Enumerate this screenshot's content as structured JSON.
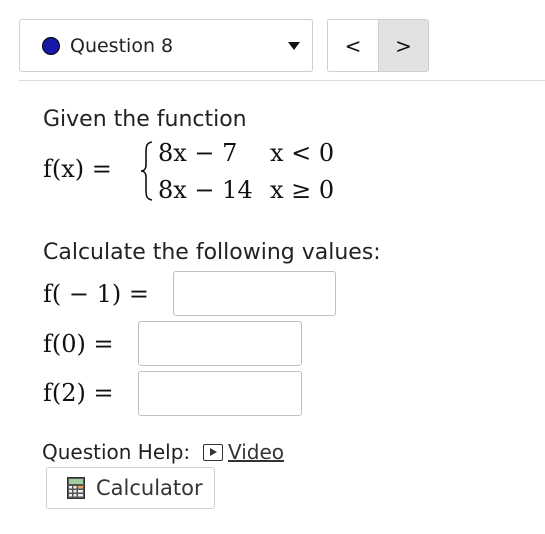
{
  "question_selector": {
    "label": "Question 8",
    "status_color": "#1818a8"
  },
  "nav": {
    "prev_symbol": "<",
    "next_symbol": ">"
  },
  "prompt": {
    "intro": "Given the function",
    "function_lhs": "f(x) =",
    "cases": [
      {
        "expr": "8x − 7",
        "cond": "x < 0"
      },
      {
        "expr": "8x − 14",
        "cond": "x ≥ 0"
      }
    ],
    "instruction": "Calculate the following values:"
  },
  "questions": [
    {
      "label": "f( − 1) =",
      "value": ""
    },
    {
      "label": "f(0) =",
      "value": ""
    },
    {
      "label": "f(2) =",
      "value": ""
    }
  ],
  "help": {
    "label": "Question Help:",
    "video_label": "Video",
    "video_icon": "video-play-icon",
    "calculator_label": "Calculator",
    "calculator_icon": "calculator-icon"
  }
}
